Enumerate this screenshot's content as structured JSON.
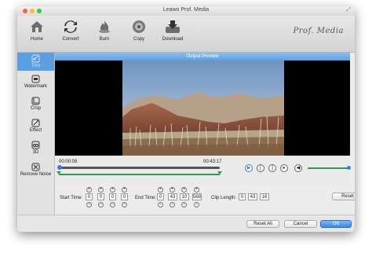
{
  "window": {
    "title": "Leawo Prof. Media"
  },
  "toolbar": {
    "items": [
      {
        "label": "Home",
        "icon": "home-icon"
      },
      {
        "label": "Convert",
        "icon": "convert-icon"
      },
      {
        "label": "Burn",
        "icon": "burn-icon"
      },
      {
        "label": "Copy",
        "icon": "copy-icon"
      },
      {
        "label": "Download",
        "icon": "download-icon"
      }
    ],
    "brand": "Prof. Media"
  },
  "sidebar": {
    "items": [
      {
        "label": "Trim",
        "icon": "trim-icon",
        "active": true
      },
      {
        "label": "Watermark",
        "icon": "watermark-icon"
      },
      {
        "label": "Crop",
        "icon": "crop-icon"
      },
      {
        "label": "Effect",
        "icon": "effect-icon"
      },
      {
        "label": "3D",
        "icon": "3d-icon"
      },
      {
        "label": "Remove Noise",
        "icon": "remove-noise-icon"
      }
    ]
  },
  "preview": {
    "header": "Output Preview"
  },
  "playback": {
    "start_time": "00:00:08",
    "end_time": "00:43:17",
    "progress": 0.0,
    "volume": 0.9
  },
  "trim": {
    "start_label": "Start Time:",
    "start": [
      "0",
      "0",
      "0",
      "0"
    ],
    "end_label": "End Time:",
    "end": [
      "0",
      "43",
      "10",
      "568"
    ],
    "clip_label": "Clip Length:",
    "clip": [
      "0",
      "43",
      "16"
    ],
    "reset_label": "Reset"
  },
  "footer": {
    "reset_all": "Reset All",
    "cancel": "Cancel",
    "ok": "OK"
  },
  "colors": {
    "accent": "#5b9fe0",
    "green": "#2f9a4b"
  }
}
